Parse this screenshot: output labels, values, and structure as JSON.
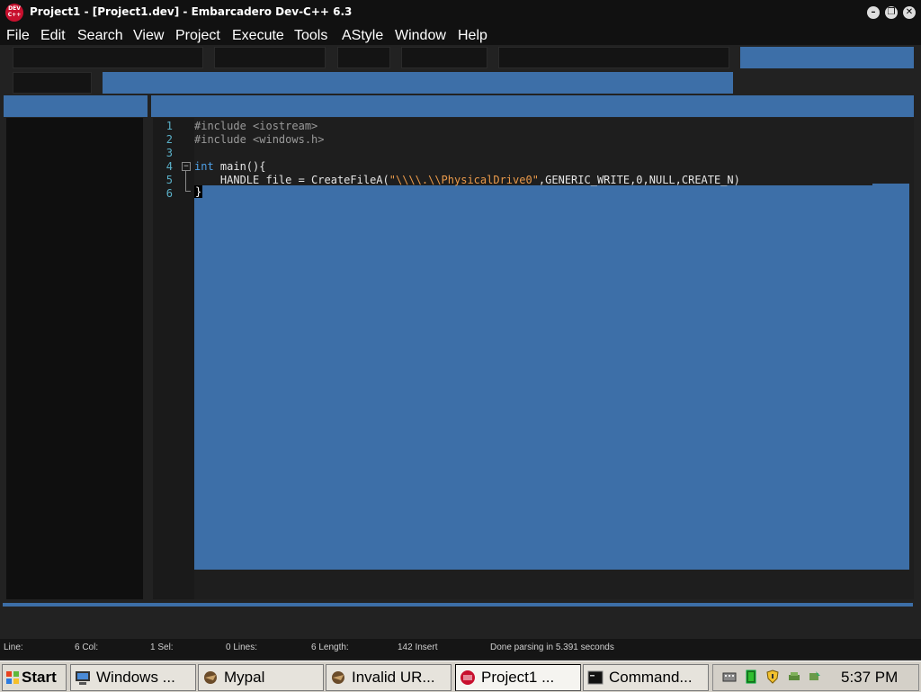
{
  "window": {
    "title": "Project1 - [Project1.dev] - Embarcadero Dev-C++ 6.3",
    "icon_text": "DEV C++",
    "controls": [
      "minimize",
      "restore",
      "close"
    ]
  },
  "menu": [
    "File",
    "Edit",
    "Search",
    "View",
    "Project",
    "Execute",
    "Tools",
    "AStyle",
    "Window",
    "Help"
  ],
  "editor": {
    "line_numbers": [
      "1",
      "2",
      "3",
      "4",
      "5",
      "6"
    ],
    "lines": {
      "l1": "#include <iostream>",
      "l2": "#include <windows.h>",
      "l3": "",
      "l4_kw": "int",
      "l4_rest": " main(){",
      "l5_pre": "    HANDLE file = CreateFileA(",
      "l5_str": "\"\\\\\\\\.\\\\PhysicalDrive0\"",
      "l5_post": ",GENERIC_WRITE,0,NULL,CREATE_N)",
      "l6": "}"
    },
    "fold_marker": "−"
  },
  "status": {
    "line": "Line:",
    "col": "6 Col:",
    "sel": "1 Sel:",
    "lines": "0 Lines:",
    "length": "6 Length:",
    "insert": "142 Insert",
    "message": "Done parsing in 5.391 seconds"
  },
  "taskbar": {
    "start": "Start",
    "tasks": [
      "Windows ...",
      "Mypal",
      "Invalid UR...",
      "Project1 ...",
      "Command..."
    ],
    "active_task": "Project1 ...",
    "clock": "5:37 PM"
  },
  "colors": {
    "accent": "#3d6fa8",
    "background": "#1c1c1c",
    "line_number": "#5ab0c8",
    "keyword": "#4ea0e6",
    "string": "#e99a4b"
  }
}
